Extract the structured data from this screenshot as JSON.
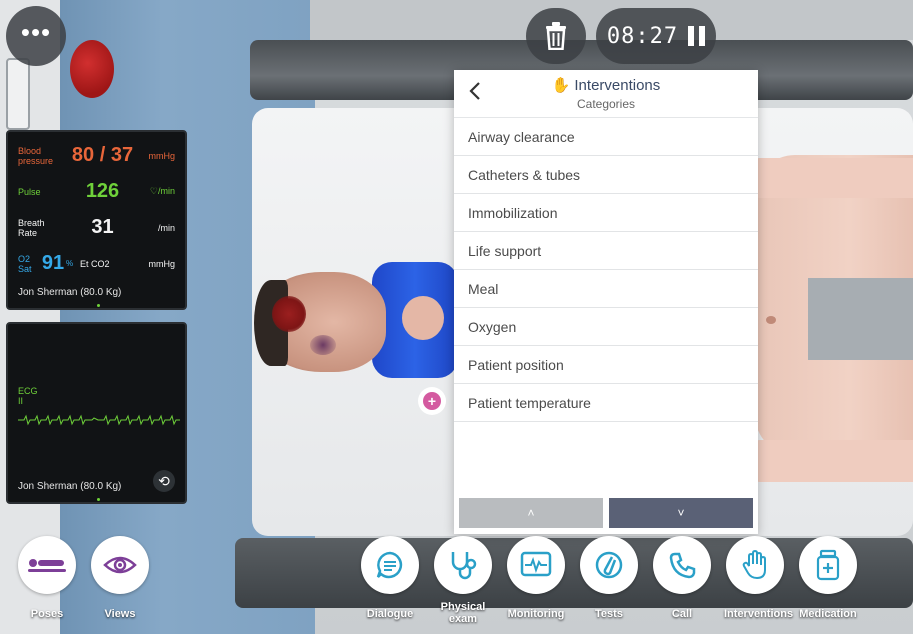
{
  "colors": {
    "accent_purple": "#7d3f98",
    "icon_blue": "#2aa0c8",
    "bp_orange": "#e8663a",
    "pulse_green": "#6fd13a",
    "o2_blue": "#35a9e8",
    "panel_title": "#3a4a66",
    "scroll_down_bg": "#5a6176"
  },
  "top_bar": {
    "menu_icon": "ellipsis-icon",
    "trash_icon": "trash-icon",
    "timer": "08:27",
    "pause_icon": "pause-icon"
  },
  "vitals": {
    "bp": {
      "label": "Blood pressure",
      "value": "80 / 37",
      "unit": "mmHg"
    },
    "pulse": {
      "label": "Pulse",
      "value": "126",
      "unit": "♡/min"
    },
    "breath": {
      "label": "Breath Rate",
      "value": "31",
      "unit": "/min"
    },
    "o2": {
      "label": "O2 Sat",
      "value": "91",
      "pct": "%",
      "etco2_label": "Et CO2",
      "unit": "mmHg"
    },
    "patient": "Jon Sherman (80.0 Kg)"
  },
  "ecg": {
    "label": "ECG II",
    "patient": "Jon Sherman (80.0 Kg)",
    "rotate_icon": "rotate-icon"
  },
  "interventions": {
    "back_icon": "chevron-left-icon",
    "title": "Interventions",
    "subtitle": "Categories",
    "categories": [
      "Airway clearance",
      "Catheters & tubes",
      "Immobilization",
      "Life support",
      "Meal",
      "Oxygen",
      "Patient position",
      "Patient temperature"
    ],
    "scroll_up": "˄",
    "scroll_down": "˅"
  },
  "toolbar": {
    "poses": "Poses",
    "views": "Views",
    "dialogue": "Dialogue",
    "physical_exam": "Physical exam",
    "monitoring": "Monitoring",
    "tests": "Tests",
    "call": "Call",
    "interventions": "Interventions",
    "medication": "Medication"
  }
}
